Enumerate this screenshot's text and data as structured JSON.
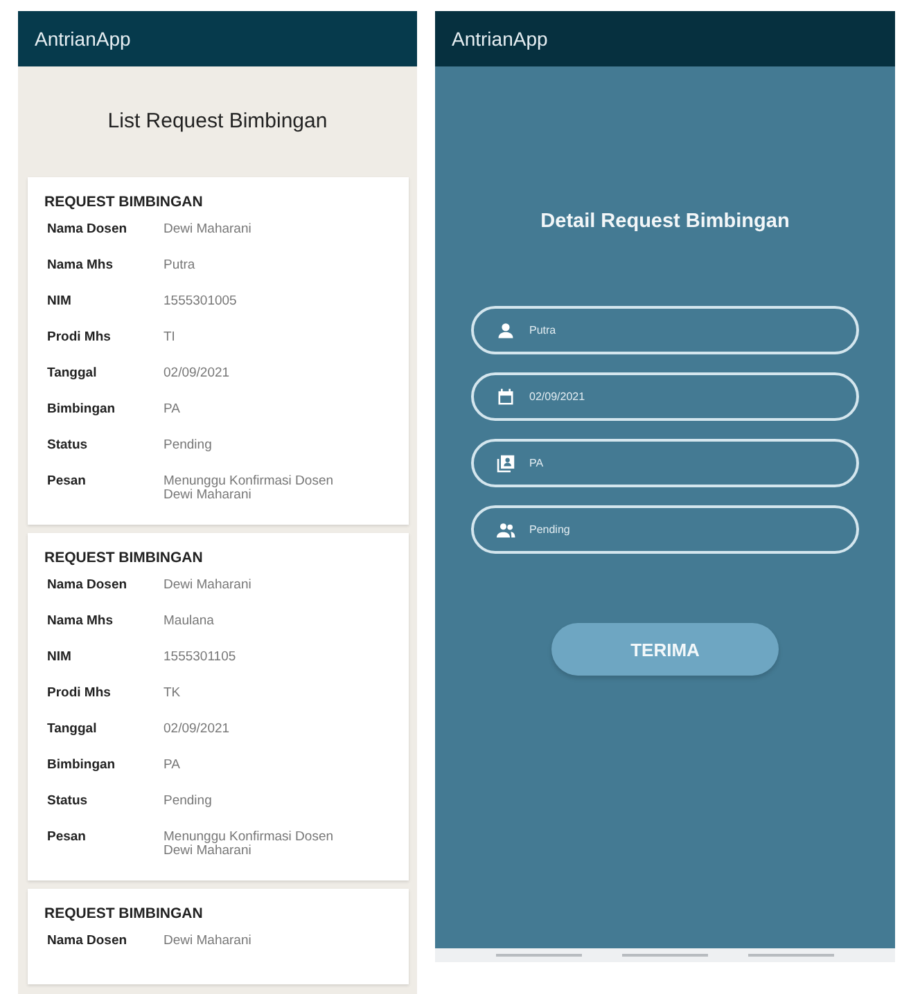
{
  "list_screen": {
    "app_bar_title": "AntrianApp",
    "heading": "List Request Bimbingan",
    "cards": [
      {
        "title": "REQUEST BIMBINGAN",
        "rows": [
          {
            "label": "Nama Dosen",
            "value": "Dewi Maharani"
          },
          {
            "label": "Nama Mhs",
            "value": "Putra"
          },
          {
            "label": "NIM",
            "value": "1555301005"
          },
          {
            "label": "Prodi Mhs",
            "value": "TI"
          },
          {
            "label": "Tanggal",
            "value": "02/09/2021"
          },
          {
            "label": "Bimbingan",
            "value": "PA"
          },
          {
            "label": "Status",
            "value": "Pending"
          },
          {
            "label": "Pesan",
            "value": "Menunggu Konfirmasi Dosen Dewi Maharani"
          }
        ]
      },
      {
        "title": "REQUEST BIMBINGAN",
        "rows": [
          {
            "label": "Nama Dosen",
            "value": "Dewi Maharani"
          },
          {
            "label": "Nama Mhs",
            "value": "Maulana"
          },
          {
            "label": "NIM",
            "value": "1555301105"
          },
          {
            "label": "Prodi Mhs",
            "value": "TK"
          },
          {
            "label": "Tanggal",
            "value": "02/09/2021"
          },
          {
            "label": "Bimbingan",
            "value": "PA"
          },
          {
            "label": "Status",
            "value": "Pending"
          },
          {
            "label": "Pesan",
            "value": "Menunggu Konfirmasi Dosen Dewi Maharani"
          }
        ]
      },
      {
        "title": "REQUEST BIMBINGAN",
        "rows": [
          {
            "label": "Nama Dosen",
            "value": "Dewi Maharani"
          }
        ]
      }
    ]
  },
  "detail_screen": {
    "app_bar_title": "AntrianApp",
    "heading": "Detail Request Bimbingan",
    "fields": [
      {
        "kind": "person",
        "value": "Putra"
      },
      {
        "kind": "date",
        "value": "02/09/2021"
      },
      {
        "kind": "contact",
        "value": "PA"
      },
      {
        "kind": "group",
        "value": "Pending"
      }
    ],
    "button": "TERIMA"
  }
}
